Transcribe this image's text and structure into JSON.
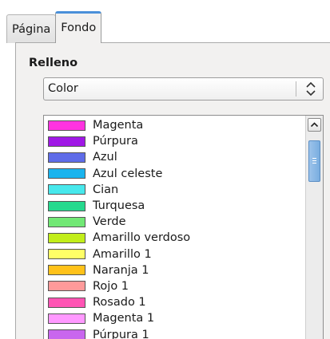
{
  "tabs": [
    {
      "label": "Página",
      "active": false
    },
    {
      "label": "Fondo",
      "active": true
    }
  ],
  "fill": {
    "section_label": "Relleno",
    "type_value": "Color"
  },
  "colors": [
    {
      "name": "Magenta",
      "hex": "#ff33e0"
    },
    {
      "name": "Púrpura",
      "hex": "#a018e6"
    },
    {
      "name": "Azul",
      "hex": "#5f6ce8"
    },
    {
      "name": "Azul celeste",
      "hex": "#1ab4ee"
    },
    {
      "name": "Cian",
      "hex": "#47e8ec"
    },
    {
      "name": "Turquesa",
      "hex": "#25d98e"
    },
    {
      "name": "Verde",
      "hex": "#71e875"
    },
    {
      "name": "Amarillo verdoso",
      "hex": "#c2ee1a"
    },
    {
      "name": "Amarillo 1",
      "hex": "#ffff66"
    },
    {
      "name": "Naranja 1",
      "hex": "#ffc21a"
    },
    {
      "name": "Rojo 1",
      "hex": "#ff9a9a"
    },
    {
      "name": "Rosado 1",
      "hex": "#ff54b4"
    },
    {
      "name": "Magenta 1",
      "hex": "#ff99ff"
    },
    {
      "name": "Púrpura 1",
      "hex": "#c966ee"
    }
  ],
  "accent": "#4a90d9"
}
